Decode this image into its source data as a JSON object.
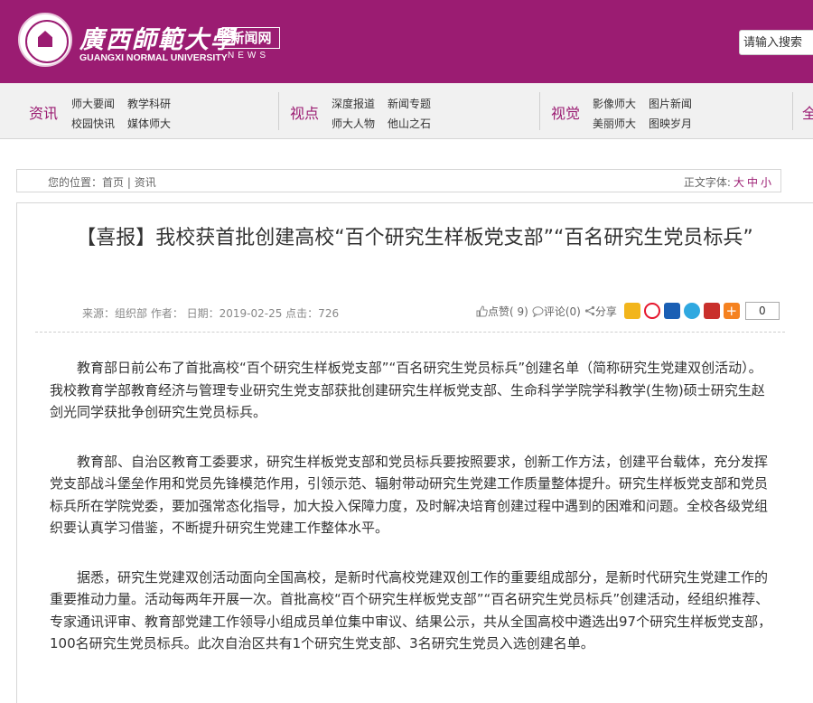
{
  "header": {
    "logo_cn": "廣西師範大學",
    "logo_en": "GUANGXI NORMAL UNIVERSITY",
    "news_cn": "新闻网",
    "news_en": "NEWS",
    "search_placeholder": "请输入搜索",
    "brand_color": "#9b1c72"
  },
  "nav": {
    "groups": [
      {
        "head": "资讯",
        "links": [
          "师大要闻",
          "教学科研",
          "校园快讯",
          "媒体师大"
        ]
      },
      {
        "head": "视点",
        "links": [
          "深度报道",
          "新闻专题",
          "师大人物",
          "他山之石"
        ]
      },
      {
        "head": "视觉",
        "links": [
          "影像师大",
          "图片新闻",
          "美丽师大",
          "图映岁月"
        ]
      },
      {
        "head": "全"
      }
    ]
  },
  "breadcrumb": {
    "prefix": "您的位置：",
    "items": [
      "首页",
      "资讯"
    ],
    "sep": " | ",
    "font_label": "正文字体:",
    "sizes": [
      "大",
      "中",
      "小"
    ]
  },
  "article": {
    "title": "【喜报】我校获首批创建高校“百个研究生样板党支部”“百名研究生党员标兵”",
    "meta": "来源：组织部 作者： 日期：2019-02-25 点击：726",
    "actions": {
      "like": "点赞( 9)",
      "comment": "评论(0)",
      "share": "分享",
      "count": "0"
    },
    "share_icons": [
      {
        "name": "qzone-icon",
        "color": "#f2b51c"
      },
      {
        "name": "weibo-icon",
        "color": "#e6162d"
      },
      {
        "name": "renren-icon",
        "color": "#1a5fb4"
      },
      {
        "name": "tqq-icon",
        "color": "#2fa8e0"
      },
      {
        "name": "kaixin-icon",
        "color": "#c9302c"
      },
      {
        "name": "more-icon",
        "color": "#f58220"
      }
    ],
    "paragraphs": [
      "教育部日前公布了首批高校“百个研究生样板党支部”“百名研究生党员标兵”创建名单（简称研究生党建双创活动）。我校教育学部教育经济与管理专业研究生党支部获批创建研究生样板党支部、生命科学学院学科教学(生物)硕士研究生赵剑光同学获批争创研究生党员标兵。",
      "教育部、自治区教育工委要求，研究生样板党支部和党员标兵要按照要求，创新工作方法，创建平台载体，充分发挥党支部战斗堡垒作用和党员先锋模范作用，引领示范、辐射带动研究生党建工作质量整体提升。研究生样板党支部和党员标兵所在学院党委，要加强常态化指导，加大投入保障力度，及时解决培育创建过程中遇到的困难和问题。全校各级党组织要认真学习借鉴，不断提升研究生党建工作整体水平。",
      "据悉，研究生党建双创活动面向全国高校，是新时代高校党建双创工作的重要组成部分，是新时代研究生党建工作的重要推动力量。活动每两年开展一次。首批高校“百个研究生样板党支部”“百名研究生党员标兵”创建活动，经组织推荐、专家通讯评审、教育部党建工作领导小组成员单位集中审议、结果公示，共从全国高校中遴选出97个研究生样板党支部，100名研究生党员标兵。此次自治区共有1个研究生党支部、3名研究生党员入选创建名单。"
    ]
  }
}
